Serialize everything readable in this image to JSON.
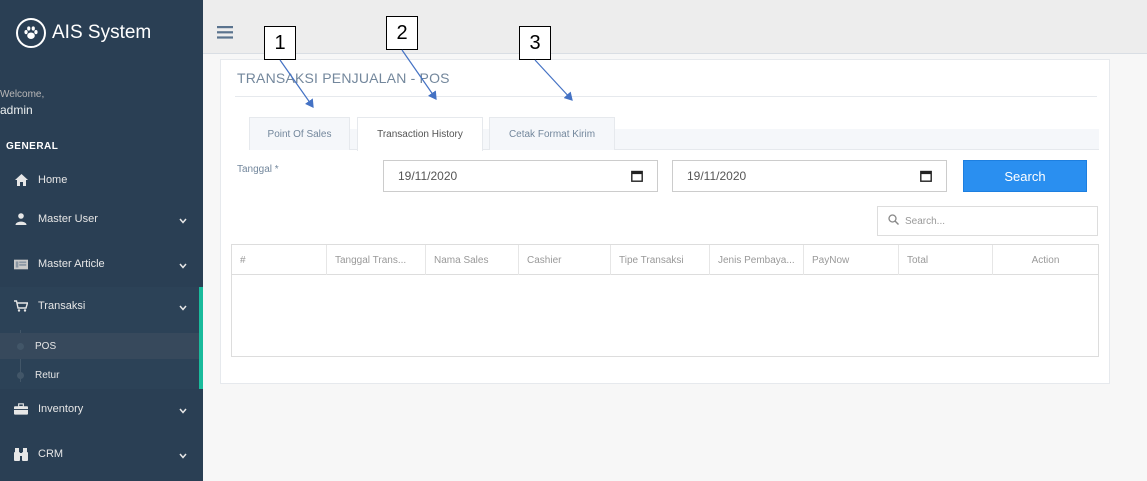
{
  "sidebar": {
    "brand": "AIS System",
    "welcome": "Welcome,",
    "username": "admin",
    "section": "GENERAL",
    "items": [
      {
        "label": "Home",
        "icon": "home-icon"
      },
      {
        "label": "Master User",
        "icon": "user-icon"
      },
      {
        "label": "Master Article",
        "icon": "article-icon"
      },
      {
        "label": "Transaksi",
        "icon": "cart-icon"
      },
      {
        "label": "Inventory",
        "icon": "briefcase-icon"
      },
      {
        "label": "CRM",
        "icon": "binoculars-icon"
      }
    ],
    "sub_items": [
      {
        "label": "POS"
      },
      {
        "label": "Retur"
      }
    ]
  },
  "page": {
    "title": "TRANSAKSI PENJUALAN - POS",
    "tabs": [
      {
        "label": "Point Of Sales"
      },
      {
        "label": "Transaction History"
      },
      {
        "label": "Cetak Format Kirim"
      }
    ],
    "active_tab": "Transaction History",
    "date_label": "Tanggal *",
    "date_from": "19/11/2020",
    "date_to": "19/11/2020",
    "search_button": "Search",
    "table_search_placeholder": "Search...",
    "columns": [
      "#",
      "Tanggal Trans...",
      "Nama Sales",
      "Cashier",
      "Tipe Transaksi",
      "Jenis Pembaya...",
      "PayNow",
      "Total",
      "Action"
    ]
  },
  "annotations": [
    "1",
    "2",
    "3"
  ],
  "colors": {
    "sidebar": "#2a3f54",
    "accent": "#1abb9c",
    "button": "#2a8ff0"
  }
}
